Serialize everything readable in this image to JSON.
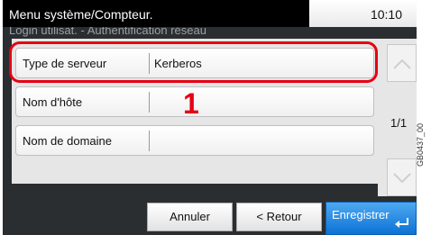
{
  "header": {
    "title": "Menu système/Compteur.",
    "time": "10:10"
  },
  "breadcrumb": "Login utilisat. - Authentification réseau",
  "rows": [
    {
      "label": "Type de serveur",
      "value": "Kerberos"
    },
    {
      "label": "Nom d'hôte",
      "value": ""
    },
    {
      "label": "Nom de domaine",
      "value": ""
    }
  ],
  "marker": "1",
  "pagination": {
    "text": "1/1"
  },
  "buttons": {
    "cancel": "Annuler",
    "back": "< Retour",
    "save": "Enregistrer"
  },
  "caption": "GB0437_00",
  "colors": {
    "highlight": "#e60012",
    "save_button": "#1a82e2"
  },
  "icons": {
    "scroll_up": "chevron-up-icon",
    "scroll_down": "chevron-down-icon",
    "enter": "enter-icon"
  }
}
